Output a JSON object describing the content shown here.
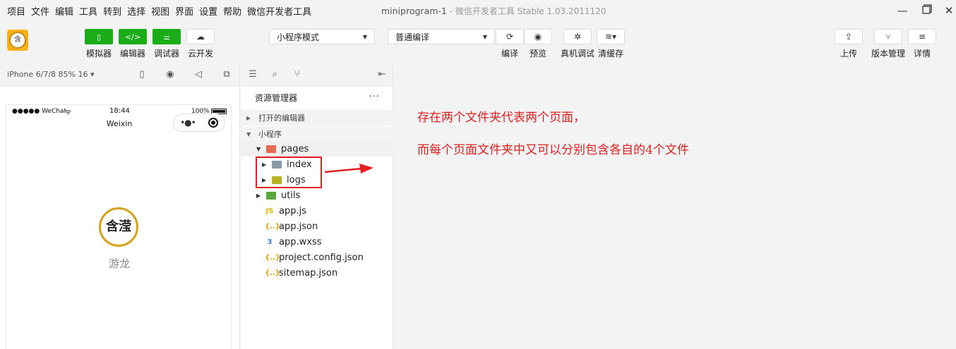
{
  "menu": [
    "项目",
    "文件",
    "编辑",
    "工具",
    "转到",
    "选择",
    "视图",
    "界面",
    "设置",
    "帮助",
    "微信开发者工具"
  ],
  "window": {
    "title": "miniprogram-1",
    "subtitle": " - 微信开发者工具 Stable 1.03.2011120"
  },
  "toolbar": {
    "left": [
      {
        "label": "模拟器",
        "glyph": "▯",
        "style": "green"
      },
      {
        "label": "编辑器",
        "glyph": "</>",
        "style": "green"
      },
      {
        "label": "调试器",
        "glyph": "⚌",
        "style": "green"
      },
      {
        "label": "云开发",
        "glyph": "☁",
        "style": "white"
      }
    ],
    "mode_select": "小程序模式",
    "compile_select": "普通编译",
    "center": [
      {
        "label": "编译",
        "glyph": "⟳"
      },
      {
        "label": "预览",
        "glyph": "◉"
      },
      {
        "label": "真机调试",
        "glyph": "✲"
      },
      {
        "label": "清缓存",
        "glyph": "≋▾"
      }
    ],
    "right": [
      {
        "label": "上传",
        "glyph": "⇪"
      },
      {
        "label": "版本管理",
        "glyph": "⑂"
      },
      {
        "label": "详情",
        "glyph": "≡"
      }
    ]
  },
  "simulator": {
    "device": "iPhone 6/7/8 85% 16 ▾",
    "status_left": "●●●●● WeChat",
    "status_time": "18:44",
    "status_battery": "100%",
    "nav_title": "Weixin",
    "logo_text": "含滢",
    "app_name": "游龙"
  },
  "explorer": {
    "title": "资源管理器",
    "more": "···",
    "open_editors": "打开的编辑器",
    "project": "小程序",
    "tree": [
      {
        "name": "pages",
        "type": "folder",
        "level": 1,
        "expanded": true,
        "color": "#e56a4f"
      },
      {
        "name": "index",
        "type": "folder",
        "level": 2,
        "expanded": false,
        "color": "#8a99a8"
      },
      {
        "name": "logs",
        "type": "folder",
        "level": 2,
        "expanded": false,
        "color": "#b8b020"
      },
      {
        "name": "utils",
        "type": "folder",
        "level": 1,
        "expanded": false,
        "color": "#5aa83c"
      },
      {
        "name": "app.js",
        "type": "js",
        "level": 1,
        "icon": "JS",
        "color": "#e8b700"
      },
      {
        "name": "app.json",
        "type": "json",
        "level": 1,
        "icon": "{..}",
        "color": "#e8a000"
      },
      {
        "name": "app.wxss",
        "type": "wxss",
        "level": 1,
        "icon": "3",
        "color": "#2f7fd6"
      },
      {
        "name": "project.config.json",
        "type": "json",
        "level": 1,
        "icon": "{..}",
        "color": "#e8a000"
      },
      {
        "name": "sitemap.json",
        "type": "json",
        "level": 1,
        "icon": "{..}",
        "color": "#e8a000"
      }
    ]
  },
  "annotation": {
    "line1": "存在两个文件夹代表两个页面，",
    "line2": "而每个页面文件夹中又可以分别包含各自的4个文件",
    "color": "#e02020"
  }
}
